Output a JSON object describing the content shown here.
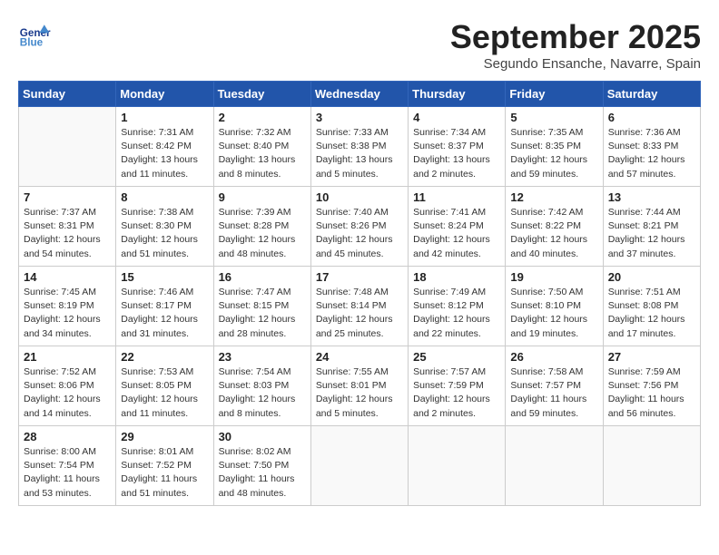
{
  "header": {
    "logo_general": "General",
    "logo_blue": "Blue",
    "month": "September 2025",
    "location": "Segundo Ensanche, Navarre, Spain"
  },
  "days_of_week": [
    "Sunday",
    "Monday",
    "Tuesday",
    "Wednesday",
    "Thursday",
    "Friday",
    "Saturday"
  ],
  "weeks": [
    [
      {
        "day": "",
        "info": ""
      },
      {
        "day": "1",
        "info": "Sunrise: 7:31 AM\nSunset: 8:42 PM\nDaylight: 13 hours\nand 11 minutes."
      },
      {
        "day": "2",
        "info": "Sunrise: 7:32 AM\nSunset: 8:40 PM\nDaylight: 13 hours\nand 8 minutes."
      },
      {
        "day": "3",
        "info": "Sunrise: 7:33 AM\nSunset: 8:38 PM\nDaylight: 13 hours\nand 5 minutes."
      },
      {
        "day": "4",
        "info": "Sunrise: 7:34 AM\nSunset: 8:37 PM\nDaylight: 13 hours\nand 2 minutes."
      },
      {
        "day": "5",
        "info": "Sunrise: 7:35 AM\nSunset: 8:35 PM\nDaylight: 12 hours\nand 59 minutes."
      },
      {
        "day": "6",
        "info": "Sunrise: 7:36 AM\nSunset: 8:33 PM\nDaylight: 12 hours\nand 57 minutes."
      }
    ],
    [
      {
        "day": "7",
        "info": "Sunrise: 7:37 AM\nSunset: 8:31 PM\nDaylight: 12 hours\nand 54 minutes."
      },
      {
        "day": "8",
        "info": "Sunrise: 7:38 AM\nSunset: 8:30 PM\nDaylight: 12 hours\nand 51 minutes."
      },
      {
        "day": "9",
        "info": "Sunrise: 7:39 AM\nSunset: 8:28 PM\nDaylight: 12 hours\nand 48 minutes."
      },
      {
        "day": "10",
        "info": "Sunrise: 7:40 AM\nSunset: 8:26 PM\nDaylight: 12 hours\nand 45 minutes."
      },
      {
        "day": "11",
        "info": "Sunrise: 7:41 AM\nSunset: 8:24 PM\nDaylight: 12 hours\nand 42 minutes."
      },
      {
        "day": "12",
        "info": "Sunrise: 7:42 AM\nSunset: 8:22 PM\nDaylight: 12 hours\nand 40 minutes."
      },
      {
        "day": "13",
        "info": "Sunrise: 7:44 AM\nSunset: 8:21 PM\nDaylight: 12 hours\nand 37 minutes."
      }
    ],
    [
      {
        "day": "14",
        "info": "Sunrise: 7:45 AM\nSunset: 8:19 PM\nDaylight: 12 hours\nand 34 minutes."
      },
      {
        "day": "15",
        "info": "Sunrise: 7:46 AM\nSunset: 8:17 PM\nDaylight: 12 hours\nand 31 minutes."
      },
      {
        "day": "16",
        "info": "Sunrise: 7:47 AM\nSunset: 8:15 PM\nDaylight: 12 hours\nand 28 minutes."
      },
      {
        "day": "17",
        "info": "Sunrise: 7:48 AM\nSunset: 8:14 PM\nDaylight: 12 hours\nand 25 minutes."
      },
      {
        "day": "18",
        "info": "Sunrise: 7:49 AM\nSunset: 8:12 PM\nDaylight: 12 hours\nand 22 minutes."
      },
      {
        "day": "19",
        "info": "Sunrise: 7:50 AM\nSunset: 8:10 PM\nDaylight: 12 hours\nand 19 minutes."
      },
      {
        "day": "20",
        "info": "Sunrise: 7:51 AM\nSunset: 8:08 PM\nDaylight: 12 hours\nand 17 minutes."
      }
    ],
    [
      {
        "day": "21",
        "info": "Sunrise: 7:52 AM\nSunset: 8:06 PM\nDaylight: 12 hours\nand 14 minutes."
      },
      {
        "day": "22",
        "info": "Sunrise: 7:53 AM\nSunset: 8:05 PM\nDaylight: 12 hours\nand 11 minutes."
      },
      {
        "day": "23",
        "info": "Sunrise: 7:54 AM\nSunset: 8:03 PM\nDaylight: 12 hours\nand 8 minutes."
      },
      {
        "day": "24",
        "info": "Sunrise: 7:55 AM\nSunset: 8:01 PM\nDaylight: 12 hours\nand 5 minutes."
      },
      {
        "day": "25",
        "info": "Sunrise: 7:57 AM\nSunset: 7:59 PM\nDaylight: 12 hours\nand 2 minutes."
      },
      {
        "day": "26",
        "info": "Sunrise: 7:58 AM\nSunset: 7:57 PM\nDaylight: 11 hours\nand 59 minutes."
      },
      {
        "day": "27",
        "info": "Sunrise: 7:59 AM\nSunset: 7:56 PM\nDaylight: 11 hours\nand 56 minutes."
      }
    ],
    [
      {
        "day": "28",
        "info": "Sunrise: 8:00 AM\nSunset: 7:54 PM\nDaylight: 11 hours\nand 53 minutes."
      },
      {
        "day": "29",
        "info": "Sunrise: 8:01 AM\nSunset: 7:52 PM\nDaylight: 11 hours\nand 51 minutes."
      },
      {
        "day": "30",
        "info": "Sunrise: 8:02 AM\nSunset: 7:50 PM\nDaylight: 11 hours\nand 48 minutes."
      },
      {
        "day": "",
        "info": ""
      },
      {
        "day": "",
        "info": ""
      },
      {
        "day": "",
        "info": ""
      },
      {
        "day": "",
        "info": ""
      }
    ]
  ]
}
